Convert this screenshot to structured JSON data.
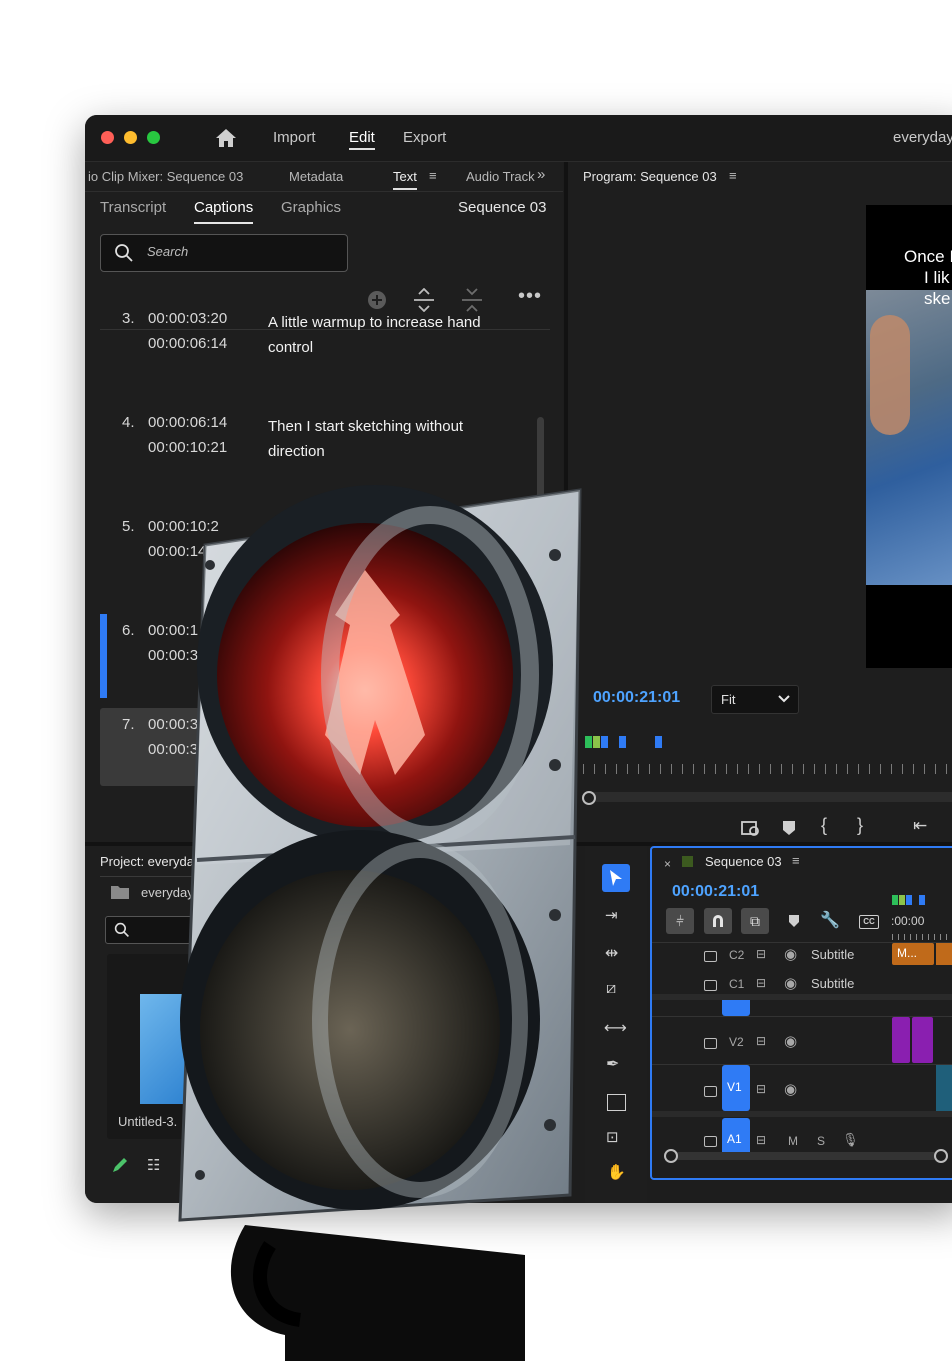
{
  "titlebar": {
    "menu": [
      "Import",
      "Edit",
      "Export"
    ],
    "active_menu": "Edit",
    "project_name": "everyday"
  },
  "left_panel": {
    "tabs": [
      "io Clip Mixer: Sequence 03",
      "Metadata",
      "Text",
      "Audio Track"
    ],
    "active_tab": "Text",
    "subtabs": [
      "Transcript",
      "Captions",
      "Graphics"
    ],
    "active_subtab": "Captions",
    "sequence_label": "Sequence 03",
    "search_placeholder": "Search",
    "captions": [
      {
        "num": "3.",
        "in": "00:00:03:20",
        "out": "00:00:06:14",
        "text": "A little warmup to increase hand control"
      },
      {
        "num": "4.",
        "in": "00:00:06:14",
        "out": "00:00:10:21",
        "text": "Then I start sketching without direction"
      },
      {
        "num": "5.",
        "in": "00:00:10:2",
        "out": "00:00:14:",
        "text": ""
      },
      {
        "num": "6.",
        "in": "00:00:1",
        "out": "00:00:3",
        "text": ""
      },
      {
        "num": "7.",
        "in": "00:00:3",
        "out": "00:00:3",
        "text": ""
      }
    ]
  },
  "program": {
    "title": "Program: Sequence 03",
    "timecode": "00:00:21:01",
    "fit_label": "Fit",
    "video_text": [
      "Once I",
      "I lik",
      "ske"
    ]
  },
  "project_panel": {
    "title": "Project: everyda",
    "bin": "everyday",
    "clip": "Untitled-3."
  },
  "timeline": {
    "title": "Sequence 03",
    "timecode": "00:00:21:01",
    "ruler": ":00:00",
    "clip_label": "M...",
    "tracks": [
      {
        "id": "C2",
        "name": "Subtitle"
      },
      {
        "id": "C1",
        "name": "Subtitle"
      },
      {
        "id": "V2",
        "name": ""
      },
      {
        "id": "V1",
        "name": ""
      },
      {
        "id": "A1",
        "name": ""
      }
    ],
    "audio_flags": [
      "M",
      "S"
    ]
  },
  "icons": [
    "home-icon",
    "search-icon",
    "add-icon",
    "expand-icon",
    "collapse-icon",
    "more-icon",
    "selection-tool-icon",
    "track-select-icon",
    "ripple-edit-icon",
    "razor-icon",
    "slip-icon",
    "pen-icon",
    "rectangle-icon",
    "hand-icon",
    "lock-icon",
    "eye-icon",
    "wrench-icon",
    "captions-icon",
    "marker-icon",
    "magnet-icon"
  ],
  "colors": {
    "accent_blue": "#2f7bf5",
    "timecode_blue": "#4ea3ff",
    "clip_purple": "#8a1fb0",
    "clip_orange": "#c06a1a",
    "window_bg": "#1d1d1d"
  }
}
